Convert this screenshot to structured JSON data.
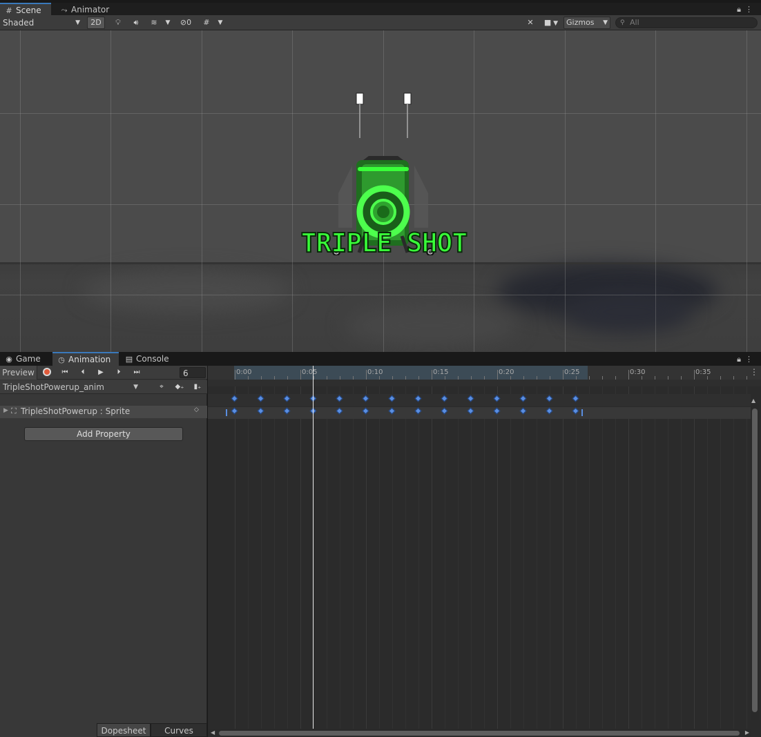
{
  "scene_window": {
    "tabs": [
      {
        "label": "Scene",
        "icon": "grid-icon"
      },
      {
        "label": "Animator",
        "icon": "animator-icon"
      }
    ],
    "toolbar": {
      "draw_mode": "Shaded",
      "btn_2d": "2D",
      "hidden_count": "0",
      "gizmos_label": "Gizmos",
      "search_placeholder": "All"
    },
    "object_text": "TRIPLE SHOT"
  },
  "animation_window": {
    "tabs": [
      {
        "label": "Game",
        "icon": "gamepad-icon"
      },
      {
        "label": "Animation",
        "icon": "clock-icon"
      },
      {
        "label": "Console",
        "icon": "console-icon"
      }
    ],
    "preview_label": "Preview",
    "frame_value": "6",
    "clip_name": "TripleShotPowerup_anim",
    "property_name": "TripleShotPowerup : Sprite",
    "add_property_label": "Add Property",
    "timeline_labels": [
      "0:00",
      "0:05",
      "0:10",
      "0:15",
      "0:20",
      "0:25",
      "0:30",
      "0:35"
    ],
    "bottom_tabs": [
      "Dopesheet",
      "Curves"
    ]
  }
}
